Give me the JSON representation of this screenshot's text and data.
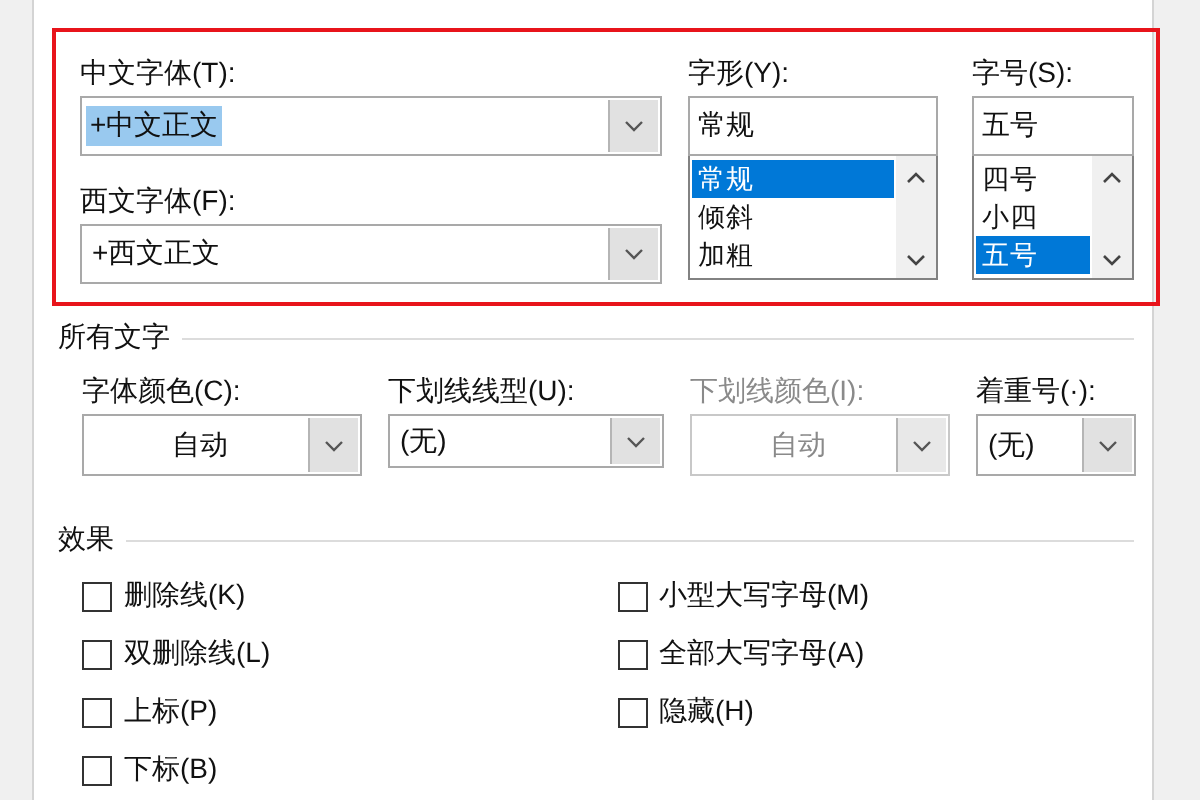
{
  "font_section": {
    "outlined": true,
    "chinese_font": {
      "label": "中文字体(T):",
      "value": "+中文正文",
      "text_selected": true
    },
    "western_font": {
      "label": "西文字体(F):",
      "value": "+西文正文",
      "text_selected": false
    },
    "font_style": {
      "label": "字形(Y):",
      "value": "常规",
      "options": [
        {
          "label": "常规",
          "selected": true
        },
        {
          "label": "倾斜",
          "selected": false
        },
        {
          "label": "加粗",
          "selected": false
        }
      ]
    },
    "font_size": {
      "label": "字号(S):",
      "value": "五号",
      "options": [
        {
          "label": "四号",
          "selected": false
        },
        {
          "label": "小四",
          "selected": false
        },
        {
          "label": "五号",
          "selected": true
        }
      ]
    }
  },
  "all_text": {
    "title": "所有文字",
    "fields": [
      {
        "kind": "color",
        "label": "字体颜色(C):",
        "value": "自动",
        "disabled": false
      },
      {
        "kind": "list",
        "label": "下划线线型(U):",
        "value": "(无)",
        "disabled": false
      },
      {
        "kind": "color",
        "label": "下划线颜色(I):",
        "value": "自动",
        "disabled": true
      },
      {
        "kind": "list",
        "label": "着重号(·):",
        "value": "(无)",
        "disabled": false
      }
    ]
  },
  "effects": {
    "title": "效果",
    "left_column": [
      {
        "label": "删除线(K)",
        "checked": false
      },
      {
        "label": "双删除线(L)",
        "checked": false
      },
      {
        "label": "上标(P)",
        "checked": false
      },
      {
        "label": "下标(B)",
        "checked": false
      }
    ],
    "right_column": [
      {
        "label": "小型大写字母(M)",
        "checked": false
      },
      {
        "label": "全部大写字母(A)",
        "checked": false
      },
      {
        "label": "隐藏(H)",
        "checked": false
      }
    ]
  }
}
